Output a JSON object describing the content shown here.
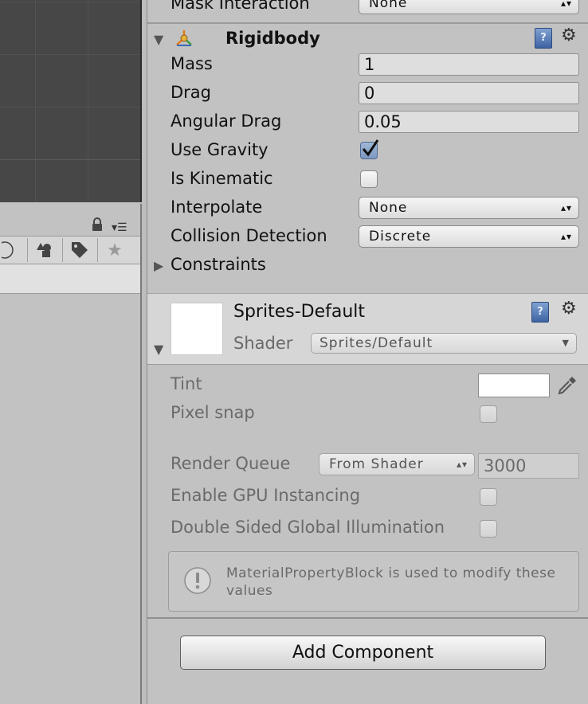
{
  "inspector": {
    "mask_interaction": {
      "label": "Mask Interaction",
      "value": "None"
    },
    "rigidbody": {
      "title": "Rigidbody",
      "mass": {
        "label": "Mass",
        "value": "1"
      },
      "drag": {
        "label": "Drag",
        "value": "0"
      },
      "angular_drag": {
        "label": "Angular Drag",
        "value": "0.05"
      },
      "use_gravity": {
        "label": "Use Gravity",
        "checked": true
      },
      "is_kinematic": {
        "label": "Is Kinematic",
        "checked": false
      },
      "interpolate": {
        "label": "Interpolate",
        "value": "None"
      },
      "collision_detection": {
        "label": "Collision Detection",
        "value": "Discrete"
      },
      "constraints": {
        "label": "Constraints"
      }
    },
    "material": {
      "name": "Sprites-Default",
      "shader_label": "Shader",
      "shader_value": "Sprites/Default",
      "tint": {
        "label": "Tint",
        "color": "#ffffff"
      },
      "pixel_snap": {
        "label": "Pixel snap",
        "checked": false
      },
      "render_queue": {
        "label": "Render Queue",
        "mode": "From Shader",
        "value": "3000"
      },
      "gpu_instancing": {
        "label": "Enable GPU Instancing",
        "checked": false
      },
      "double_sided_gi": {
        "label": "Double Sided Global Illumination",
        "checked": false
      },
      "info_message": "MaterialPropertyBlock is used to modify these values"
    },
    "add_component_label": "Add Component",
    "help_glyph": "?"
  },
  "colors": {
    "panel_bg": "#c2c2c2",
    "scene_bg": "#474747",
    "checkbox_checked": "#7d98c0"
  }
}
